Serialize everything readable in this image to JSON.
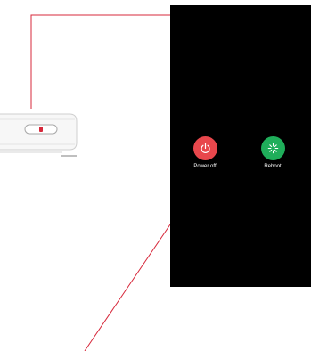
{
  "screen": {
    "background": "#000000"
  },
  "power_menu": {
    "options": [
      {
        "label": "Power off",
        "icon": "power-icon",
        "color": "#e8474c"
      },
      {
        "label": "Reboot",
        "icon": "refresh-spinner-icon",
        "color": "#1fae5a"
      }
    ]
  },
  "annotation": {
    "callout_color": "#d7283b",
    "side_button_color": "#d7283b"
  }
}
